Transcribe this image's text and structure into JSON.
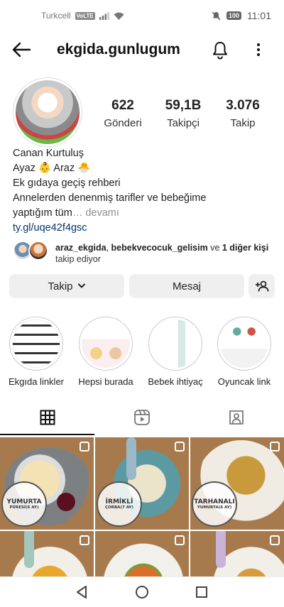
{
  "status_bar": {
    "carrier": "Turkcell",
    "volte": "VoLTE",
    "battery": "100",
    "time": "11:01"
  },
  "header": {
    "username": "ekgida.gunlugum"
  },
  "stats": [
    {
      "value": "622",
      "label": "Gönderi"
    },
    {
      "value": "59,1B",
      "label": "Takipçi"
    },
    {
      "value": "3.076",
      "label": "Takip"
    }
  ],
  "bio": {
    "name": "Canan Kurtuluş",
    "line1": "Ayaz 👶 Araz 🐣",
    "line2": "Ek gıdaya geçiş rehberi",
    "line3": "Annelerden denenmiş tarifler ve bebeğime",
    "line4": "yaptığım tüm",
    "more": "… devamı",
    "link": "ty.gl/uqe42f4gsc"
  },
  "followed_by": {
    "user1": "araz_ekgida",
    "sep1": ", ",
    "user2": "bebekvecocuk_gelisim",
    "sep2": " ve ",
    "others": "1 diğer kişi",
    "suffix": " takip ediyor"
  },
  "buttons": {
    "follow": "Takip",
    "message": "Mesaj"
  },
  "highlights": [
    {
      "label": "Ekgıda linkler"
    },
    {
      "label": "Hepsi burada"
    },
    {
      "label": "Bebek ihtiyaç"
    },
    {
      "label": "Oyuncak link"
    }
  ],
  "posts": [
    {
      "badge_title": "YUMURTA",
      "badge_sub": "PÜRESİ(6 AY)"
    },
    {
      "badge_title": "İRMİKLİ",
      "badge_sub": "ÇORBA(7 AY)"
    },
    {
      "badge_title": "TARHANALI",
      "badge_sub": "YUMURTA(6 AY)"
    }
  ]
}
